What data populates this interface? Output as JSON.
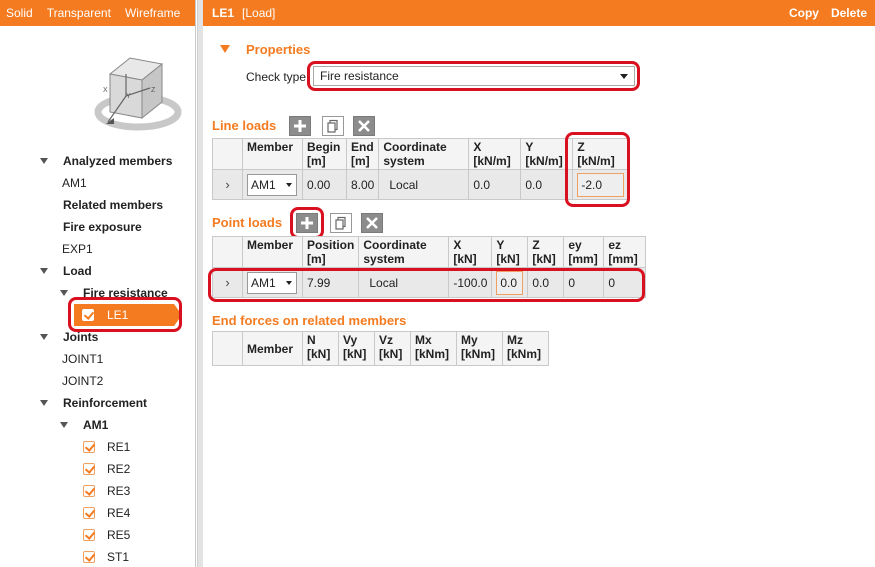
{
  "viewbar": {
    "solid": "Solid",
    "transparent": "Transparent",
    "wireframe": "Wireframe"
  },
  "header": {
    "item": "LE1",
    "type": "[Load]",
    "copy": "Copy",
    "delete": "Delete"
  },
  "tree": {
    "analyzed_members": "Analyzed members",
    "am1": "AM1",
    "related_members": "Related members",
    "fire_exposure": "Fire exposure",
    "exp1": "EXP1",
    "load": "Load",
    "fire_resistance": "Fire resistance",
    "le1": "LE1",
    "joints": "Joints",
    "joint1": "JOINT1",
    "joint2": "JOINT2",
    "reinforcement": "Reinforcement",
    "am1_group": "AM1",
    "re": [
      "RE1",
      "RE2",
      "RE3",
      "RE4",
      "RE5",
      "ST1"
    ]
  },
  "properties": {
    "title": "Properties",
    "check_type_label": "Check type",
    "check_type_value": "Fire resistance"
  },
  "line_loads": {
    "title": "Line loads",
    "headers": [
      "Member",
      "Begin [m]",
      "End [m]",
      "Coordinate system",
      "X [kN/m]",
      "Y [kN/m]",
      "Z [kN/m]"
    ],
    "row": {
      "member": "AM1",
      "begin": "0.00",
      "end": "8.00",
      "coord": "Local",
      "x": "0.0",
      "y": "0.0",
      "z": "-2.0"
    }
  },
  "point_loads": {
    "title": "Point loads",
    "headers": [
      "Member",
      "Position [m]",
      "Coordinate system",
      "X [kN]",
      "Y [kN]",
      "Z [kN]",
      "ey [mm]",
      "ez [mm]"
    ],
    "row": {
      "member": "AM1",
      "position": "7.99",
      "coord": "Local",
      "x": "-100.0",
      "y": "0.0",
      "z": "0.0",
      "ey": "0",
      "ez": "0"
    }
  },
  "end_forces": {
    "title": "End forces on related members",
    "headers": [
      "Member",
      "N [kN]",
      "Vy [kN]",
      "Vz [kN]",
      "Mx [kNm]",
      "My [kNm]",
      "Mz [kNm]"
    ]
  },
  "colors": {
    "accent": "#f47b20",
    "highlight": "#d91020"
  }
}
